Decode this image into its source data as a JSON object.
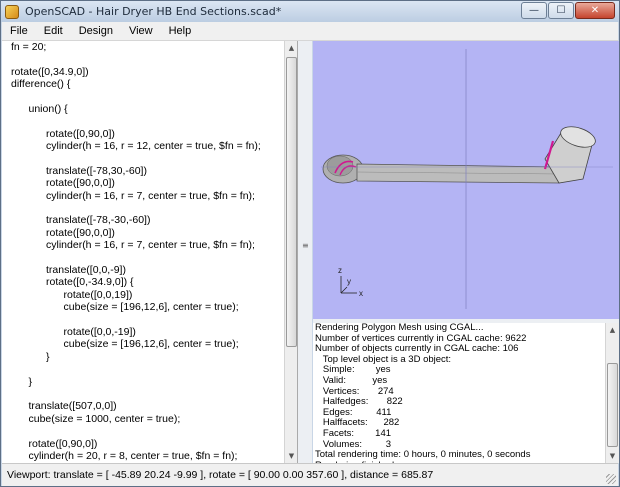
{
  "window": {
    "title": "OpenSCAD - Hair Dryer HB End Sections.scad*",
    "minimize_glyph": "—",
    "maximize_glyph": "☐",
    "close_glyph": "✕"
  },
  "menu": [
    "File",
    "Edit",
    "Design",
    "View",
    "Help"
  ],
  "editor": {
    "lines": [
      "fn = 20;",
      "",
      "rotate([0,34.9,0])",
      "difference() {",
      "",
      "      union() {",
      "",
      "            rotate([0,90,0])",
      "            cylinder(h = 16, r = 12, center = true, $fn = fn);",
      "",
      "            translate([-78,30,-60])",
      "            rotate([90,0,0])",
      "            cylinder(h = 16, r = 7, center = true, $fn = fn);",
      "",
      "            translate([-78,-30,-60])",
      "            rotate([90,0,0])",
      "            cylinder(h = 16, r = 7, center = true, $fn = fn);",
      "",
      "            translate([0,0,-9])",
      "            rotate([0,-34.9,0]) {",
      "                  rotate([0,0,19])",
      "                  cube(size = [196,12,6], center = true);",
      "",
      "                  rotate([0,0,-19])",
      "                  cube(size = [196,12,6], center = true);",
      "            }",
      "",
      "      }",
      "",
      "      translate([507,0,0])",
      "      cube(size = 1000, center = true);",
      "",
      "      rotate([0,90,0])",
      "      cylinder(h = 20, r = 8, center = true, $fn = fn);"
    ]
  },
  "viewport": {
    "background": "#b4b4f4",
    "model_color": "#c8c8c8",
    "highlight_color": "#d01890",
    "axis_labels": {
      "x": "x",
      "y": "y",
      "z": "z"
    }
  },
  "console": {
    "lines": [
      "Rendering Polygon Mesh using CGAL...",
      "Number of vertices currently in CGAL cache: 9622",
      "Number of objects currently in CGAL cache: 106",
      "   Top level object is a 3D object:",
      "   Simple:        yes",
      "   Valid:          yes",
      "   Vertices:       274",
      "   Halfedges:       822",
      "   Edges:         411",
      "   Halffacets:      282",
      "   Facets:        141",
      "   Volumes:         3",
      "Total rendering time: 0 hours, 0 minutes, 0 seconds",
      "Rendering finished."
    ]
  },
  "status": {
    "text": "Viewport: translate = [ -45.89 20.24 -9.99 ], rotate = [ 90.00 0.00 357.60 ], distance = 685.87"
  },
  "scroll": {
    "up_glyph": "▲",
    "down_glyph": "▼",
    "splitter_glyph": "≡"
  }
}
